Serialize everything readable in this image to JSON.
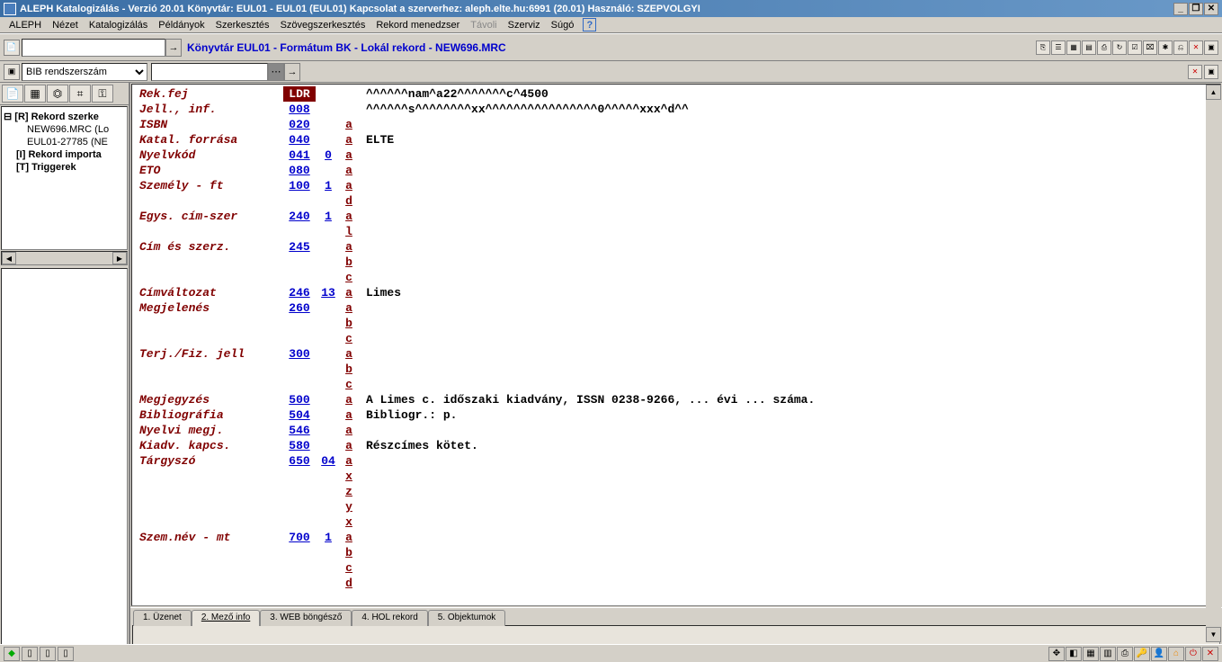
{
  "title": "ALEPH Katalogizálás - Verzió 20.01  Könyvtár: EUL01 - EUL01 (EUL01)  Kapcsolat a szerverhez:  aleph.elte.hu:6991 (20.01)  Használó:  SZEPVOLGYI",
  "menu": {
    "aleph": "ALEPH",
    "nezet": "Nézet",
    "katalog": "Katalogizálás",
    "peldanyok": "Példányok",
    "szerkesztes": "Szerkesztés",
    "szoveg": "Szövegszerkesztés",
    "rekord": "Rekord menedzser",
    "tavoli": "Távoli",
    "szerviz": "Szerviz",
    "sugo": "Súgó"
  },
  "breadcrumb": "Könyvtár EUL01 - Formátum BK - Lokál rekord - NEW696.MRC",
  "select": {
    "value": "BIB rendszerszám"
  },
  "tree": {
    "root": "[R] Rekord szerke",
    "c1": "NEW696.MRC (Lo",
    "c2": "EUL01-27785 (NE",
    "imp": "[I] Rekord importa",
    "trig": "[T] Triggerek"
  },
  "fields": [
    {
      "label": "Rek.fej",
      "tag": "LDR",
      "tagClass": "ldr",
      "ind": "",
      "subs": [
        {
          "s": "",
          "v": "^^^^^^nam^a22^^^^^^^c^4500"
        }
      ]
    },
    {
      "label": "Jell., inf.",
      "tag": "008",
      "ind": "",
      "subs": [
        {
          "s": "",
          "v": "^^^^^^s^^^^^^^^xx^^^^^^^^^^^^^^^^0^^^^^xxx^d^^"
        }
      ]
    },
    {
      "label": "ISBN",
      "tag": "020",
      "ind": "",
      "subs": [
        {
          "s": "a",
          "v": ""
        }
      ]
    },
    {
      "label": "Katal. forrása",
      "tag": "040",
      "ind": "",
      "subs": [
        {
          "s": "a",
          "v": "ELTE"
        }
      ]
    },
    {
      "label": "Nyelvkód",
      "tag": "041",
      "ind": "0",
      "subs": [
        {
          "s": "a",
          "v": ""
        }
      ]
    },
    {
      "label": "ETO",
      "tag": "080",
      "ind": "",
      "subs": [
        {
          "s": "a",
          "v": ""
        }
      ]
    },
    {
      "label": "Személy - ft",
      "tag": "100",
      "ind": "1",
      "subs": [
        {
          "s": "a",
          "v": ""
        },
        {
          "s": "d",
          "v": ""
        }
      ]
    },
    {
      "label": "Egys. cím-szer",
      "tag": "240",
      "ind": "1",
      "subs": [
        {
          "s": "a",
          "v": ""
        },
        {
          "s": "l",
          "v": ""
        }
      ]
    },
    {
      "label": "Cím és szerz.",
      "tag": "245",
      "ind": "",
      "subs": [
        {
          "s": "a",
          "v": ""
        },
        {
          "s": "b",
          "v": ""
        },
        {
          "s": "c",
          "v": ""
        }
      ]
    },
    {
      "label": "Címváltozat",
      "tag": "246",
      "ind": "13",
      "subs": [
        {
          "s": "a",
          "v": "Limes"
        }
      ]
    },
    {
      "label": "Megjelenés",
      "tag": "260",
      "ind": "",
      "subs": [
        {
          "s": "a",
          "v": ""
        },
        {
          "s": "b",
          "v": ""
        },
        {
          "s": "c",
          "v": ""
        }
      ]
    },
    {
      "label": "Terj./Fiz. jell",
      "tag": "300",
      "ind": "",
      "subs": [
        {
          "s": "a",
          "v": ""
        },
        {
          "s": "b",
          "v": ""
        },
        {
          "s": "c",
          "v": ""
        }
      ]
    },
    {
      "label": "Megjegyzés",
      "tag": "500",
      "ind": "",
      "subs": [
        {
          "s": "a",
          "v": "A Limes c. időszaki kiadvány, ISSN 0238-9266, ... évi ... száma."
        }
      ]
    },
    {
      "label": "Bibliográfia",
      "tag": "504",
      "ind": "",
      "subs": [
        {
          "s": "a",
          "v": "Bibliogr.: p."
        }
      ]
    },
    {
      "label": "Nyelvi megj.",
      "tag": "546",
      "ind": "",
      "subs": [
        {
          "s": "a",
          "v": ""
        }
      ]
    },
    {
      "label": "Kiadv. kapcs.",
      "tag": "580",
      "ind": "",
      "subs": [
        {
          "s": "a",
          "v": "Részcímes kötet."
        }
      ]
    },
    {
      "label": "Tárgyszó",
      "tag": "650",
      "ind": "04",
      "subs": [
        {
          "s": "a",
          "v": ""
        },
        {
          "s": "x",
          "v": ""
        },
        {
          "s": "z",
          "v": ""
        },
        {
          "s": "y",
          "v": ""
        },
        {
          "s": "x",
          "v": ""
        }
      ]
    },
    {
      "label": "Szem.név - mt",
      "tag": "700",
      "ind": "1",
      "subs": [
        {
          "s": "a",
          "v": ""
        },
        {
          "s": "b",
          "v": ""
        },
        {
          "s": "c",
          "v": ""
        },
        {
          "s": "d",
          "v": ""
        }
      ]
    }
  ],
  "tabs": {
    "t1": "1. Üzenet",
    "t2": "2. Mező info",
    "t3": "3. WEB böngésző",
    "t4": "4. HOL rekord",
    "t5": "5. Objektumok"
  }
}
